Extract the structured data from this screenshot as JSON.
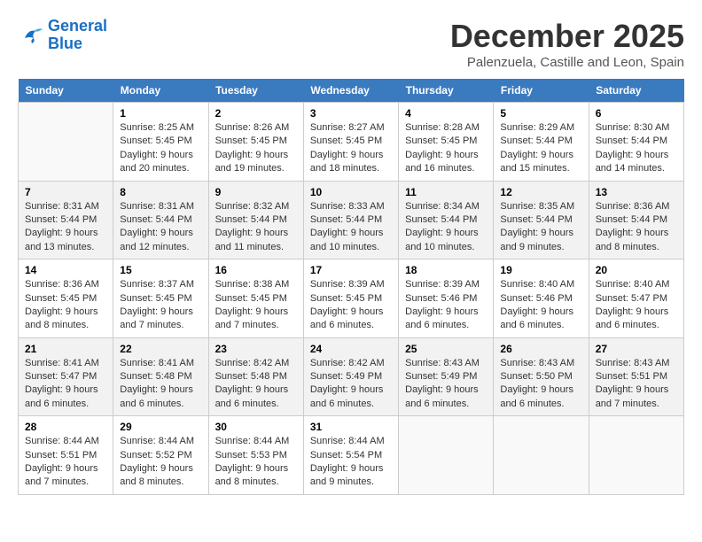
{
  "header": {
    "logo_line1": "General",
    "logo_line2": "Blue",
    "month_title": "December 2025",
    "location": "Palenzuela, Castille and Leon, Spain"
  },
  "days_of_week": [
    "Sunday",
    "Monday",
    "Tuesday",
    "Wednesday",
    "Thursday",
    "Friday",
    "Saturday"
  ],
  "weeks": [
    [
      {
        "day": "",
        "info": ""
      },
      {
        "day": "1",
        "info": "Sunrise: 8:25 AM\nSunset: 5:45 PM\nDaylight: 9 hours\nand 20 minutes."
      },
      {
        "day": "2",
        "info": "Sunrise: 8:26 AM\nSunset: 5:45 PM\nDaylight: 9 hours\nand 19 minutes."
      },
      {
        "day": "3",
        "info": "Sunrise: 8:27 AM\nSunset: 5:45 PM\nDaylight: 9 hours\nand 18 minutes."
      },
      {
        "day": "4",
        "info": "Sunrise: 8:28 AM\nSunset: 5:45 PM\nDaylight: 9 hours\nand 16 minutes."
      },
      {
        "day": "5",
        "info": "Sunrise: 8:29 AM\nSunset: 5:44 PM\nDaylight: 9 hours\nand 15 minutes."
      },
      {
        "day": "6",
        "info": "Sunrise: 8:30 AM\nSunset: 5:44 PM\nDaylight: 9 hours\nand 14 minutes."
      }
    ],
    [
      {
        "day": "7",
        "info": "Sunrise: 8:31 AM\nSunset: 5:44 PM\nDaylight: 9 hours\nand 13 minutes."
      },
      {
        "day": "8",
        "info": "Sunrise: 8:31 AM\nSunset: 5:44 PM\nDaylight: 9 hours\nand 12 minutes."
      },
      {
        "day": "9",
        "info": "Sunrise: 8:32 AM\nSunset: 5:44 PM\nDaylight: 9 hours\nand 11 minutes."
      },
      {
        "day": "10",
        "info": "Sunrise: 8:33 AM\nSunset: 5:44 PM\nDaylight: 9 hours\nand 10 minutes."
      },
      {
        "day": "11",
        "info": "Sunrise: 8:34 AM\nSunset: 5:44 PM\nDaylight: 9 hours\nand 10 minutes."
      },
      {
        "day": "12",
        "info": "Sunrise: 8:35 AM\nSunset: 5:44 PM\nDaylight: 9 hours\nand 9 minutes."
      },
      {
        "day": "13",
        "info": "Sunrise: 8:36 AM\nSunset: 5:44 PM\nDaylight: 9 hours\nand 8 minutes."
      }
    ],
    [
      {
        "day": "14",
        "info": "Sunrise: 8:36 AM\nSunset: 5:45 PM\nDaylight: 9 hours\nand 8 minutes."
      },
      {
        "day": "15",
        "info": "Sunrise: 8:37 AM\nSunset: 5:45 PM\nDaylight: 9 hours\nand 7 minutes."
      },
      {
        "day": "16",
        "info": "Sunrise: 8:38 AM\nSunset: 5:45 PM\nDaylight: 9 hours\nand 7 minutes."
      },
      {
        "day": "17",
        "info": "Sunrise: 8:39 AM\nSunset: 5:45 PM\nDaylight: 9 hours\nand 6 minutes."
      },
      {
        "day": "18",
        "info": "Sunrise: 8:39 AM\nSunset: 5:46 PM\nDaylight: 9 hours\nand 6 minutes."
      },
      {
        "day": "19",
        "info": "Sunrise: 8:40 AM\nSunset: 5:46 PM\nDaylight: 9 hours\nand 6 minutes."
      },
      {
        "day": "20",
        "info": "Sunrise: 8:40 AM\nSunset: 5:47 PM\nDaylight: 9 hours\nand 6 minutes."
      }
    ],
    [
      {
        "day": "21",
        "info": "Sunrise: 8:41 AM\nSunset: 5:47 PM\nDaylight: 9 hours\nand 6 minutes."
      },
      {
        "day": "22",
        "info": "Sunrise: 8:41 AM\nSunset: 5:48 PM\nDaylight: 9 hours\nand 6 minutes."
      },
      {
        "day": "23",
        "info": "Sunrise: 8:42 AM\nSunset: 5:48 PM\nDaylight: 9 hours\nand 6 minutes."
      },
      {
        "day": "24",
        "info": "Sunrise: 8:42 AM\nSunset: 5:49 PM\nDaylight: 9 hours\nand 6 minutes."
      },
      {
        "day": "25",
        "info": "Sunrise: 8:43 AM\nSunset: 5:49 PM\nDaylight: 9 hours\nand 6 minutes."
      },
      {
        "day": "26",
        "info": "Sunrise: 8:43 AM\nSunset: 5:50 PM\nDaylight: 9 hours\nand 6 minutes."
      },
      {
        "day": "27",
        "info": "Sunrise: 8:43 AM\nSunset: 5:51 PM\nDaylight: 9 hours\nand 7 minutes."
      }
    ],
    [
      {
        "day": "28",
        "info": "Sunrise: 8:44 AM\nSunset: 5:51 PM\nDaylight: 9 hours\nand 7 minutes."
      },
      {
        "day": "29",
        "info": "Sunrise: 8:44 AM\nSunset: 5:52 PM\nDaylight: 9 hours\nand 8 minutes."
      },
      {
        "day": "30",
        "info": "Sunrise: 8:44 AM\nSunset: 5:53 PM\nDaylight: 9 hours\nand 8 minutes."
      },
      {
        "day": "31",
        "info": "Sunrise: 8:44 AM\nSunset: 5:54 PM\nDaylight: 9 hours\nand 9 minutes."
      },
      {
        "day": "",
        "info": ""
      },
      {
        "day": "",
        "info": ""
      },
      {
        "day": "",
        "info": ""
      }
    ]
  ]
}
